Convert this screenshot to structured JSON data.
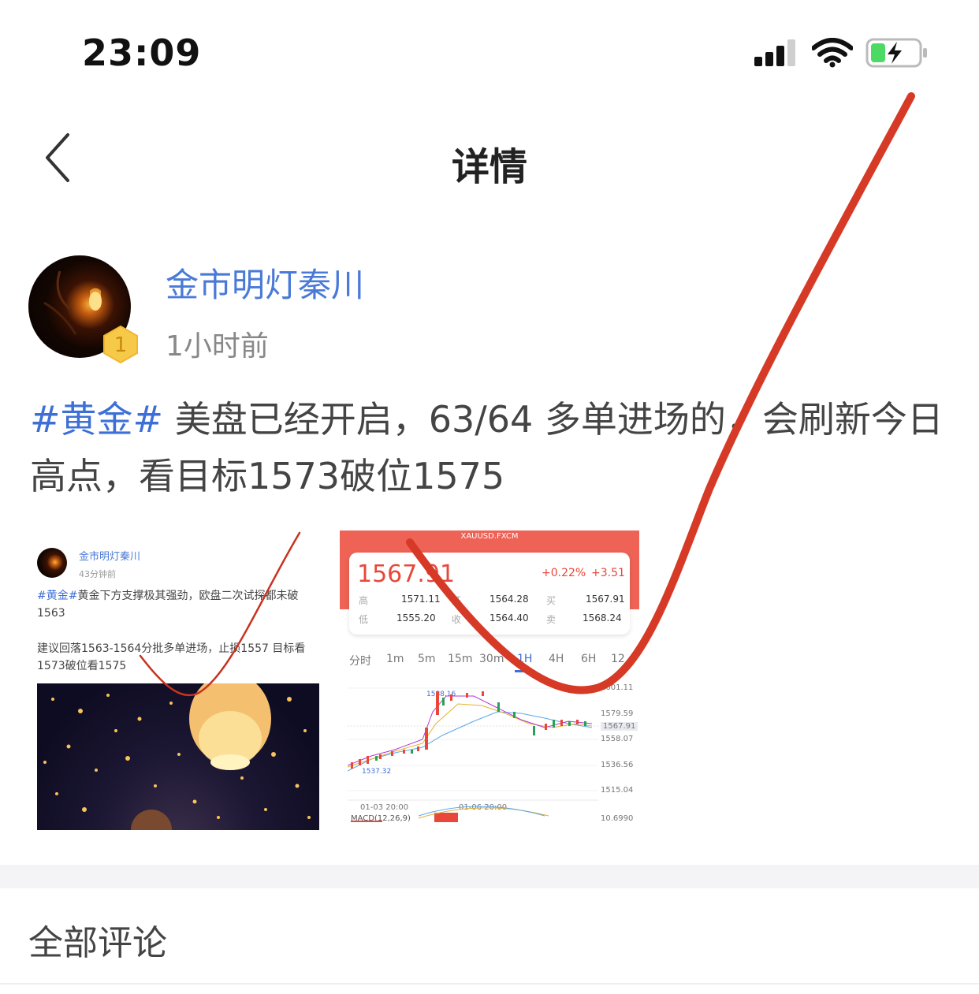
{
  "status_bar": {
    "time": "23:09",
    "battery_color": "#4cd964"
  },
  "nav": {
    "title": "详情"
  },
  "author": {
    "name": "金市明灯秦川",
    "time": "1小时前",
    "badge_level": "1"
  },
  "post": {
    "tag": "#黄金#",
    "text": "美盘已经开启，63/64 多单进场的，会刷新今日高点，看目标1573破位1575"
  },
  "thumbnail_post": {
    "author": "金市明灯秦川",
    "time": "43分钟前",
    "tag": "#黄金#",
    "text1": "黄金下方支撑极其强劲，欧盘二次试探都未破1563",
    "text2": "建议回落1563-1564分批多单进场，止损1557 目标看1573破位看1575"
  },
  "thumbnail_chart": {
    "symbol": "XAUUSD.FXCM",
    "price": "1567.91",
    "change_pct": "+0.22%",
    "change": "+3.51",
    "stats": [
      {
        "label": "高",
        "value": "1571.11"
      },
      {
        "label": "开",
        "value": "1564.28"
      },
      {
        "label": "买",
        "value": "1567.91"
      },
      {
        "label": "低",
        "value": "1555.20"
      },
      {
        "label": "收",
        "value": "1564.40"
      },
      {
        "label": "卖",
        "value": "1568.24"
      }
    ],
    "tabs": [
      "分时",
      "1m",
      "5m",
      "15m",
      "30m",
      "1H",
      "4H",
      "6H",
      "12"
    ],
    "active_tab": "1H",
    "y_labels": [
      "1601.11",
      "1579.59",
      "1567.91",
      "1558.07",
      "1536.56",
      "1515.04"
    ],
    "max_label": "1588.16",
    "min_label": "1537.32",
    "x_labels": [
      "01-03 20:00",
      "01-06 20:00"
    ],
    "macd_label": "MACD(12,26,9)",
    "macd_value": "10.6990"
  },
  "comments": {
    "title": "全部评论"
  },
  "annotation": {
    "stroke_color": "#d63a26"
  }
}
